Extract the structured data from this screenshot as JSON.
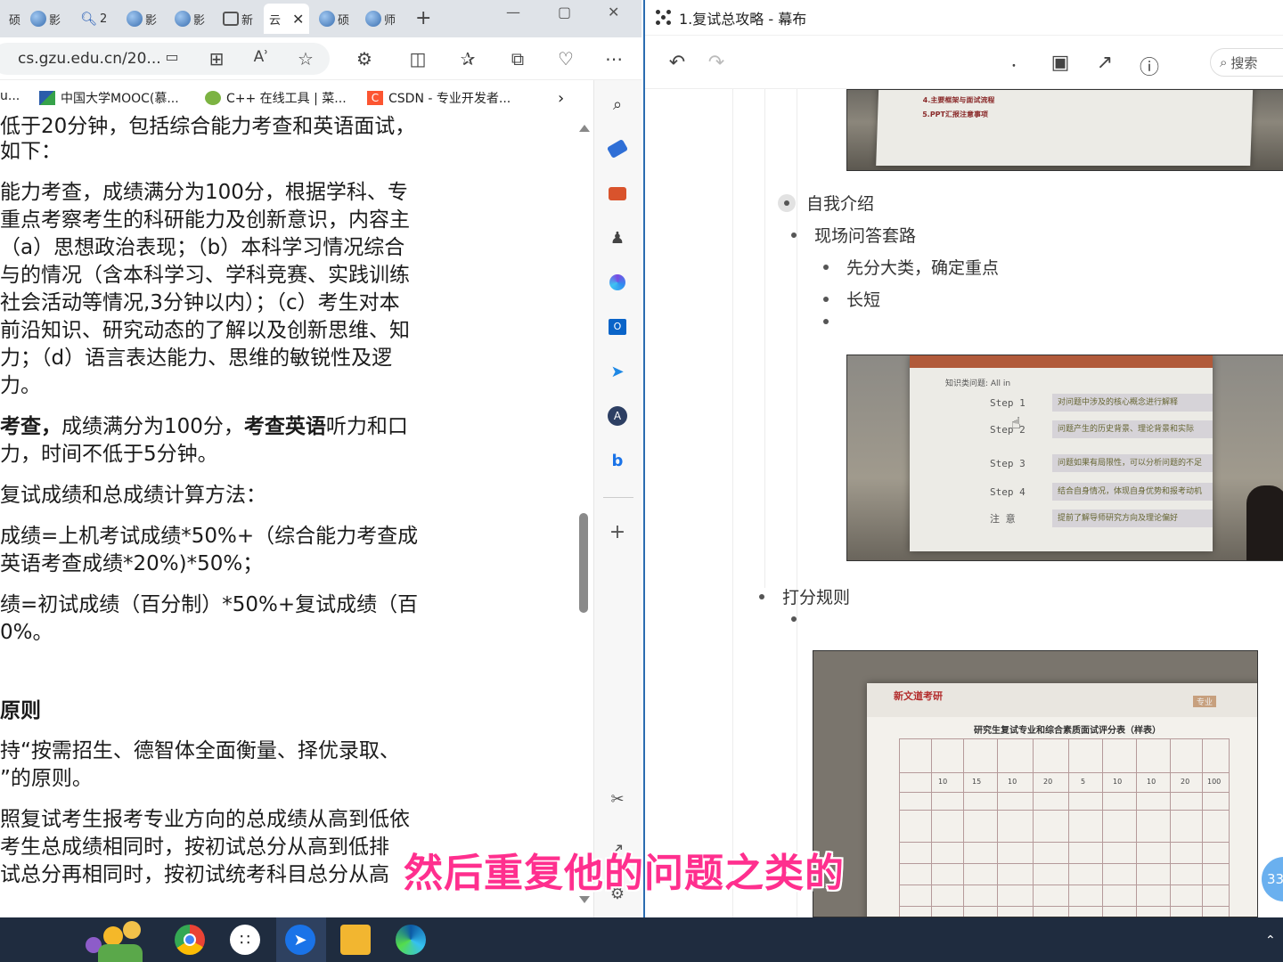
{
  "browser": {
    "tabs": [
      {
        "label": "硕",
        "active": false
      },
      {
        "label": "影",
        "active": false
      },
      {
        "label": "2",
        "active": false
      },
      {
        "label": "影",
        "active": false
      },
      {
        "label": "影",
        "active": false
      },
      {
        "label": "新",
        "active": false
      },
      {
        "label": "云",
        "active": true
      },
      {
        "label": "硕",
        "active": false
      },
      {
        "label": "师",
        "active": false
      }
    ],
    "url": "cs.gzu.edu.cn/20...",
    "bookmarks": [
      {
        "label": "u...",
        "icon": "bookmark-icon"
      },
      {
        "label": "中国大学MOOC(慕...",
        "icon": "mooc-icon"
      },
      {
        "label": "C++ 在线工具 | 菜...",
        "icon": "runoob-icon"
      },
      {
        "label": "CSDN - 专业开发者...",
        "icon": "csdn-icon"
      }
    ],
    "document": {
      "lines": [
        {
          "text": "低于20分钟，包括综合能力考查和英语面试，"
        },
        {
          "text": "如下："
        },
        {
          "text": "能力考查，成绩满分为100分，根据学科、专"
        },
        {
          "text": "重点考察考生的科研能力及创新意识，内容主"
        },
        {
          "text": "（a）思想政治表现；（b）本科学习情况综合"
        },
        {
          "text": "与的情况（含本科学习、学科竞赛、实践训练"
        },
        {
          "text": "社会活动等情况,3分钟以内）；（c）考生对本"
        },
        {
          "text": "前沿知识、研究动态的了解以及创新思维、知"
        },
        {
          "text": "力；（d）语言表达能力、思维的敏锐性及逻"
        },
        {
          "text": "力。"
        },
        {
          "text_bold_1": "考查，",
          "text_1": "成绩满分为100分，",
          "text_bold_2": "考查英语",
          "text_2": "听力和口"
        },
        {
          "text": "力，时间不低于5分钟。"
        },
        {
          "text": "复试成绩和总成绩计算方法："
        },
        {
          "text": "成绩=上机考试成绩*50%+（综合能力考查成"
        },
        {
          "text": "英语考查成绩*20%)*50%；"
        },
        {
          "text": "绩=初试成绩（百分制）*50%+复试成绩（百"
        },
        {
          "text": "0%。"
        },
        {
          "text": "原则"
        },
        {
          "text": "持“按需招生、德智体全面衡量、择优录取、"
        },
        {
          "text": "”的原则。"
        },
        {
          "text": "照复试考生报考专业方向的总成绩从高到低依"
        },
        {
          "text": "考生总成绩相同时，按初试总分从高到低排"
        },
        {
          "text": "试总分再相同时，按初试统考科目总分从高"
        }
      ]
    }
  },
  "mubu": {
    "window_title": "1.复试总攻略 - 幕布",
    "search_placeholder": "搜索",
    "outline": {
      "self_intro": "自我介绍",
      "qa_routine": "现场问答套路",
      "classify_first": "先分大类，确定重点",
      "length": "长短",
      "scoring_rules": "打分规则"
    },
    "slide1_lines": [
      "4.主要框架与面试流程",
      "5.PPT汇报注意事项"
    ],
    "slide2": {
      "header": "知识类问题: All in",
      "steps": [
        {
          "label": "Step 1",
          "text": "对问题中涉及的核心概念进行解释"
        },
        {
          "label": "Step 2",
          "text": "问题产生的历史背景、理论背景和实际"
        },
        {
          "label": "Step 3",
          "text": "问题如果有局限性，可以分析问题的不足"
        },
        {
          "label": "Step 4",
          "text": "结合自身情况，体现自身优势和报考动机"
        },
        {
          "label": "注  意",
          "text": "提前了解导师研究方向及理论偏好"
        }
      ]
    },
    "slide3": {
      "brand": "新文道考研",
      "tag": "专业",
      "title": "研究生复试专业和综合素质面试评分表（样表）",
      "weights": [
        "10",
        "15",
        "10",
        "20",
        "5",
        "10",
        "10",
        "20",
        "100"
      ]
    }
  },
  "subtitle": "然后重复他的问题之类的",
  "badge": "33"
}
